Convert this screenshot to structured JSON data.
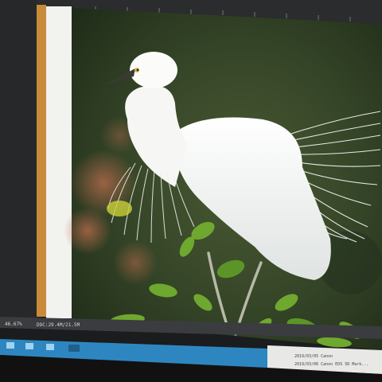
{
  "statusbar": {
    "zoom": "46.67%",
    "doc_info": "DOC:29.4M/21.5M"
  },
  "photo_meta": {
    "line1": "2019/03/05  Canon",
    "line2": "2019/03/06  Canon EOS 5D Mark..."
  },
  "colors": {
    "monitor_bezel": "#1a1c1e",
    "ruler": "#2a2c2e",
    "canvas_border_orange": "#c98b3a",
    "canvas_paper": "#f2f2ef",
    "photo_bg_dark": "#2c3a26",
    "egret_white": "#f4f5f2",
    "beak": "#3a3a32",
    "leaf_green": "#6fa82e",
    "taskbar_blue": "#2e86c1"
  },
  "icons": [
    "photoshop-window",
    "taskbar",
    "egret-photo"
  ]
}
